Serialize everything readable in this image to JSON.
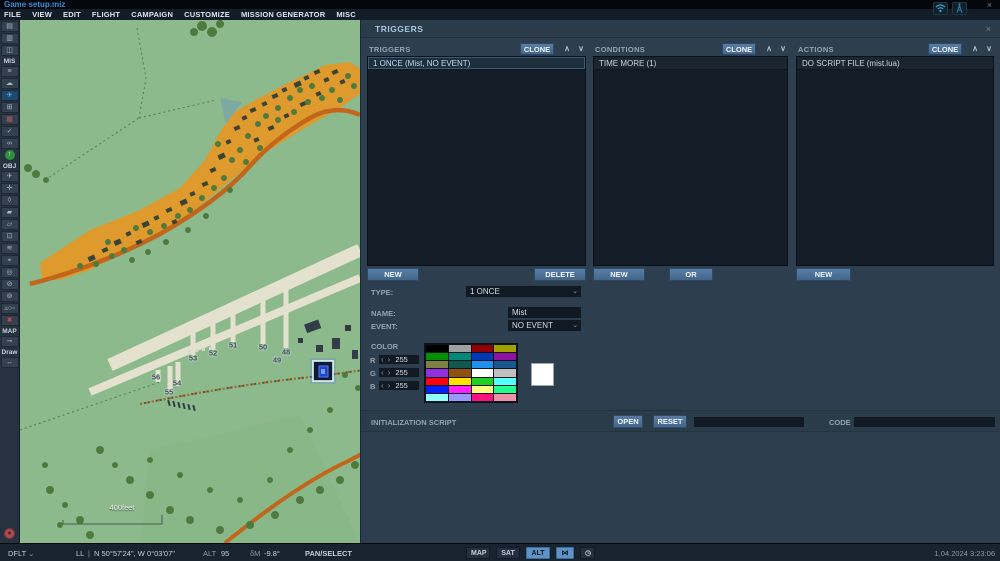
{
  "window": {
    "title": "Game setup.miz"
  },
  "icons": {
    "close": "×",
    "chevron_up": "∧",
    "chevron_down": "∨",
    "dropdown": "⌄",
    "spin_left": "‹",
    "spin_right": "›",
    "wifi": "wifi-icon",
    "antenna": "antenna-icon",
    "bridge": "⋈",
    "clock": "◷",
    "alert": "●"
  },
  "menu": {
    "items": [
      "FILE",
      "VIEW",
      "EDIT",
      "FLIGHT",
      "CAMPAIGN",
      "CUSTOMIZE",
      "MISSION GENERATOR",
      "MISC"
    ]
  },
  "toolbar": {
    "items": [
      {
        "type": "btn",
        "name": "new-mission",
        "glyph": "▤"
      },
      {
        "type": "btn",
        "name": "open-mission",
        "glyph": "▥"
      },
      {
        "type": "btn",
        "name": "save-mission",
        "glyph": "◫"
      },
      {
        "type": "label",
        "text": "MIS"
      },
      {
        "type": "btn",
        "name": "briefing",
        "glyph": "≡"
      },
      {
        "type": "btn",
        "name": "weather",
        "glyph": "☁"
      },
      {
        "type": "btn",
        "name": "mission-editor",
        "glyph": "✈",
        "state": "active"
      },
      {
        "type": "btn",
        "name": "unit-placement",
        "glyph": "⊞"
      },
      {
        "type": "btn",
        "name": "triggered-actions",
        "glyph": "▦",
        "color": "#B05A5A"
      },
      {
        "type": "btn",
        "name": "mission-goals",
        "glyph": "✓"
      },
      {
        "type": "btn",
        "name": "trigger-rules",
        "glyph": "∞"
      },
      {
        "type": "btn",
        "name": "spawn-point",
        "glyph": "↑",
        "state": "green"
      },
      {
        "type": "label",
        "text": "OBJ"
      },
      {
        "type": "btn",
        "name": "add-airplane",
        "glyph": "✈"
      },
      {
        "type": "btn",
        "name": "add-helicopter",
        "glyph": "✛"
      },
      {
        "type": "btn",
        "name": "add-ship",
        "glyph": "◊"
      },
      {
        "type": "btn",
        "name": "add-vehicle",
        "glyph": "▰"
      },
      {
        "type": "btn",
        "name": "add-static-object",
        "glyph": "▱"
      },
      {
        "type": "btn",
        "name": "add-template",
        "glyph": "⊡"
      },
      {
        "type": "btn",
        "name": "add-weapon",
        "glyph": "≋"
      },
      {
        "type": "btn",
        "name": "add-trigger-zone",
        "glyph": "⌖"
      },
      {
        "type": "btn",
        "name": "zone-tools",
        "glyph": "◎"
      },
      {
        "type": "btn",
        "name": "restricted-zone",
        "glyph": "⊘"
      },
      {
        "type": "btn",
        "name": "rings",
        "glyph": "⊚"
      },
      {
        "type": "btn",
        "name": "map-shapes",
        "glyph": "▵○▫"
      },
      {
        "type": "btn",
        "name": "delete-object",
        "glyph": "✖",
        "color": "#C24848"
      },
      {
        "type": "label",
        "text": "MAP"
      },
      {
        "type": "btn",
        "name": "map-key",
        "glyph": "⊸"
      },
      {
        "type": "label",
        "text": "Draw"
      },
      {
        "type": "btn",
        "name": "measure-distance",
        "glyph": "↔"
      }
    ]
  },
  "map": {
    "scale_label": "400feet",
    "taxiway_labels": [
      "53",
      "52",
      "51",
      "50",
      "49",
      "48",
      "56",
      "54",
      "55"
    ]
  },
  "panel": {
    "title": "TRIGGERS",
    "columns": {
      "triggers": {
        "header": "TRIGGERS",
        "clone_label": "CLONE",
        "items": [
          {
            "label": "1 ONCE (Mist, NO EVENT)",
            "selected": true
          }
        ],
        "new_label": "NEW",
        "delete_label": "DELETE"
      },
      "conditions": {
        "header": "CONDITIONS",
        "clone_label": "CLONE",
        "items": [
          {
            "label": "TIME MORE (1)",
            "selected": false
          }
        ],
        "new_label": "NEW",
        "or_label": "OR"
      },
      "actions": {
        "header": "ACTIONS",
        "clone_label": "CLONE",
        "items": [
          {
            "label": "DO SCRIPT FILE (mist.lua)",
            "selected": false
          }
        ],
        "new_label": "NEW"
      }
    },
    "fields": {
      "type_label": "TYPE:",
      "type_value": "1 ONCE",
      "name_label": "NAME:",
      "name_value": "Mist",
      "event_label": "EVENT:",
      "event_value": "NO EVENT"
    },
    "color": {
      "label": "COLOR",
      "r_label": "R",
      "g_label": "G",
      "b_label": "B",
      "r_value": "255",
      "g_value": "255",
      "b_value": "255",
      "preview": "#FFFFFF",
      "palette": [
        "#000000",
        "#A0A0A0",
        "#900000",
        "#A0A000",
        "#009000",
        "#008878",
        "#0038B8",
        "#9010A0",
        "#808040",
        "#105850",
        "#2090F0",
        "#1A5590",
        "#9030E0",
        "#905010",
        "#FFFFFF",
        "#C0C0C0",
        "#FF0010",
        "#FFE000",
        "#20D020",
        "#55FFFF",
        "#0020FF",
        "#FF20FF",
        "#FFFF80",
        "#20FF90",
        "#90FFFF",
        "#9898FF",
        "#FF1080",
        "#F090A8"
      ]
    },
    "init": {
      "label": "INITIALIZATION SCRIPT",
      "open_label": "OPEN",
      "reset_label": "RESET",
      "file_value": "",
      "code_label": "CODE",
      "code_value": ""
    }
  },
  "statusbar": {
    "layer_selector": "DFLT",
    "coord_mode": "LL",
    "coords": "N 50°57'24\", W 0°03'07\"",
    "alt_label": "ALT",
    "alt_value": "95",
    "mag_label": "δM",
    "mag_value": "-9.8°",
    "tool": "PAN/SELECT",
    "map_btn": "MAP",
    "sat_btn": "SAT",
    "alt_btn": "ALT",
    "datetime": "1.04.2024 3:23:06"
  }
}
